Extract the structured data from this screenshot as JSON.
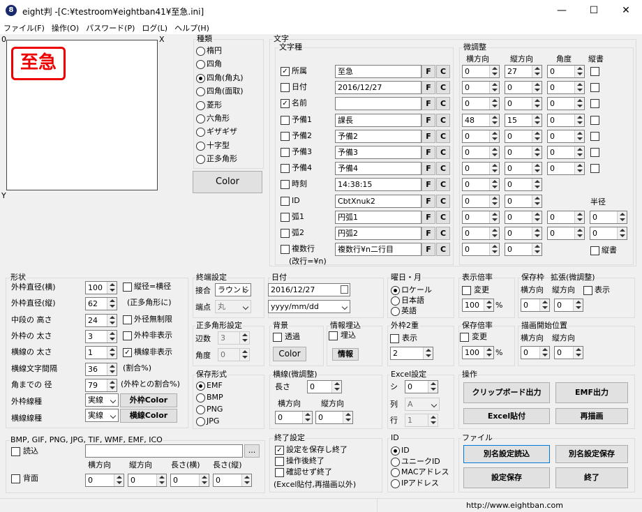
{
  "window": {
    "title": "eight判 -[C:¥testroom¥eightban41¥至急.ini]",
    "icon": "8",
    "min": "—",
    "max": "☐",
    "close": "✕"
  },
  "menu": [
    "ファイル(F)",
    "操作(O)",
    "パスワード(P)",
    "ログ(L)",
    "ヘルプ(H)"
  ],
  "preview": {
    "origin": "0",
    "x": "X",
    "y": "Y",
    "stamp": "至急"
  },
  "shape_type": {
    "label": "種類",
    "options": [
      "楕円",
      "四角",
      "四角(角丸)",
      "四角(面取)",
      "菱形",
      "六角形",
      "ギザギザ",
      "十字型",
      "正多角形"
    ],
    "selected": 2,
    "color_button": "Color"
  },
  "text": {
    "label": "文字",
    "kind_label": "文字種",
    "fine_label": "微調整",
    "col_h": "横方向",
    "col_v": "縦方向",
    "col_angle": "角度",
    "col_vert": "縦書",
    "radius_label": "半径",
    "vert_label2": "縦書",
    "rows": [
      {
        "label": "所属",
        "checked": true,
        "value": "至急",
        "h": "0",
        "v": "27",
        "a": "0",
        "vert": true
      },
      {
        "label": "日付",
        "checked": false,
        "value": "2016/12/27",
        "h": "0",
        "v": "0",
        "a": "0",
        "vert": true
      },
      {
        "label": "名前",
        "checked": true,
        "value": "",
        "h": "0",
        "v": "0",
        "a": "0",
        "vert": true
      },
      {
        "label": "予備1",
        "checked": false,
        "value": "課長",
        "h": "48",
        "v": "15",
        "a": "0",
        "vert": true
      },
      {
        "label": "予備2",
        "checked": false,
        "value": "予備2",
        "h": "0",
        "v": "0",
        "a": "0",
        "vert": true
      },
      {
        "label": "予備3",
        "checked": false,
        "value": "予備3",
        "h": "0",
        "v": "0",
        "a": "0",
        "vert": true
      },
      {
        "label": "予備4",
        "checked": false,
        "value": "予備4",
        "h": "0",
        "v": "0",
        "a": "0",
        "vert": true
      },
      {
        "label": "時刻",
        "checked": false,
        "value": "14:38:15",
        "h": "0",
        "v": "0"
      },
      {
        "label": "ID",
        "checked": false,
        "value": "CbtXnuk2",
        "h": "0",
        "v": "0"
      },
      {
        "label": "弧1",
        "checked": false,
        "value": "円弧1",
        "h": "0",
        "v": "0",
        "a": "0",
        "r": "0"
      },
      {
        "label": "弧2",
        "checked": false,
        "value": "円弧2",
        "h": "0",
        "v": "0",
        "a": "0",
        "r": "0"
      },
      {
        "label": "複数行",
        "checked": false,
        "value": "複数行¥n二行目",
        "h": "0",
        "v": "0"
      }
    ],
    "f": "F",
    "c": "C",
    "note": "(改行=¥n)"
  },
  "shape": {
    "label": "形状",
    "rows": [
      {
        "label": "外枠直径(横)",
        "value": "100"
      },
      {
        "label": "外枠直径(縦)",
        "value": "62"
      },
      {
        "label": "中段の 高さ",
        "value": "24"
      },
      {
        "label": "外枠の 太さ",
        "value": "3"
      },
      {
        "label": "横線の 太さ",
        "value": "1"
      },
      {
        "label": "横線文字間隔",
        "value": "36"
      },
      {
        "label": "角までの 径",
        "value": "79"
      }
    ],
    "chk1": "縦径=横径",
    "chk1_sub": "(正多角形に)",
    "chk2": "外径無制限",
    "chk3": "外枠非表示",
    "chk4": "横線非表示",
    "pct": "(割合%)",
    "pct2": "(外枠との割合%)",
    "outer_line_label": "外枠線種",
    "outer_line": "実線",
    "outer_color": "外枠Color",
    "hline_label": "横線線種",
    "hline": "実線",
    "hline_color": "横線Color"
  },
  "endpoint": {
    "label": "終端設定",
    "join_label": "接合",
    "join": "ラウンド",
    "cap_label": "端点",
    "cap": "丸"
  },
  "date": {
    "label": "日付",
    "value": "2016/12/27",
    "format": "yyyy/mm/dd"
  },
  "weekday": {
    "label": "曜日・月",
    "options": [
      "ロケール",
      "日本語",
      "英語"
    ],
    "selected": 0
  },
  "display_scale": {
    "label": "表示倍率",
    "chk": "変更",
    "value": "100",
    "unit": "%"
  },
  "save_frame": {
    "label": "保存枠",
    "h": "横方向",
    "h_val": "0"
  },
  "expand": {
    "label": "拡張(微調整)",
    "v": "縦方向",
    "v_val": "0",
    "chk": "表示"
  },
  "polygon": {
    "label": "正多角形設定",
    "sides_label": "辺数",
    "sides": "3",
    "angle_label": "角度",
    "angle": "0"
  },
  "background": {
    "label": "背景",
    "chk": "透過",
    "color": "Color"
  },
  "info_embed": {
    "label": "情報埋込",
    "chk": "埋込",
    "btn": "情報"
  },
  "outer_double": {
    "label": "外枠2重",
    "chk": "表示",
    "value": "2"
  },
  "save_scale": {
    "label": "保存倍率",
    "chk": "変更",
    "value": "100",
    "unit": "%"
  },
  "draw_start": {
    "label": "描画開始位置",
    "h": "横方向",
    "v": "縦方向",
    "h_val": "0",
    "v_val": "0"
  },
  "save_format": {
    "label": "保存形式",
    "options": [
      "EMF",
      "BMP",
      "PNG",
      "JPG"
    ],
    "selected": 0
  },
  "hline_fine": {
    "label": "横線(微調整)",
    "len_label": "長さ",
    "len": "0",
    "h": "横方向",
    "v": "縦方向",
    "h_val": "0",
    "v_val": "0"
  },
  "excel": {
    "label": "Excel設定",
    "sheet_label": "シ",
    "sheet": "0",
    "col_label": "列",
    "col": "A",
    "row_label": "行",
    "row": "1"
  },
  "ops": {
    "label": "操作",
    "clipboard": "クリップボード出力",
    "emf": "EMF出力",
    "excel": "Excel貼付",
    "redraw": "再描画"
  },
  "image": {
    "label": "BMP, GIF, PNG, JPG, TIF, WMF, EMF, ICO",
    "read": "読込",
    "bg": "背面",
    "browse": "...",
    "h": "横方向",
    "v": "縦方向",
    "w": "長さ(横)",
    "hh": "長さ(縦)",
    "vals": [
      "0",
      "0",
      "0",
      "0"
    ]
  },
  "exit": {
    "label": "終了設定",
    "chk1": "設定を保存し終了",
    "chk2": "操作後終了",
    "chk3": "確認せず終了",
    "note": "(Excel貼付,再描画以外)"
  },
  "id": {
    "label": "ID",
    "options": [
      "ID",
      "ユニークID",
      "MACアドレス",
      "IPアドレス"
    ],
    "selected": 0
  },
  "file": {
    "label": "ファイル",
    "load": "別名設定読込",
    "saveas": "別名設定保存",
    "save": "設定保存",
    "quit": "終了"
  },
  "status": {
    "url": "http://www.eightban.com"
  }
}
